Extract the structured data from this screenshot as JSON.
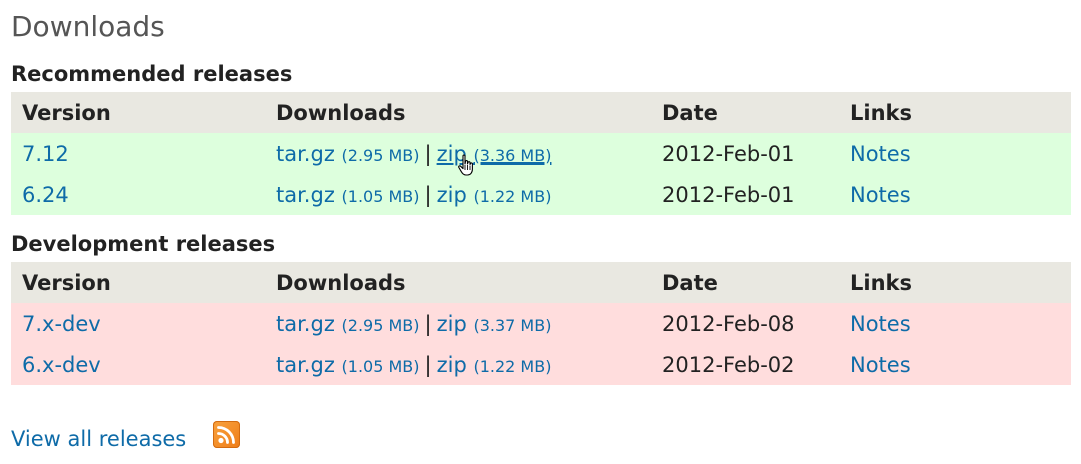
{
  "page": {
    "title": "Downloads"
  },
  "columns": {
    "version": "Version",
    "downloads": "Downloads",
    "date": "Date",
    "links": "Links"
  },
  "recommended": {
    "title": "Recommended releases",
    "rows": [
      {
        "version": "7.12",
        "targz": "tar.gz",
        "targz_size": "(2.95 MB)",
        "separator": "|",
        "zip": "zip",
        "zip_size": "(3.36 MB)",
        "date": "2012-Feb-01",
        "notes": "Notes"
      },
      {
        "version": "6.24",
        "targz": "tar.gz",
        "targz_size": "(1.05 MB)",
        "separator": "|",
        "zip": "zip",
        "zip_size": "(1.22 MB)",
        "date": "2012-Feb-01",
        "notes": "Notes"
      }
    ]
  },
  "development": {
    "title": "Development releases",
    "rows": [
      {
        "version": "7.x-dev",
        "targz": "tar.gz",
        "targz_size": "(2.95 MB)",
        "separator": "|",
        "zip": "zip",
        "zip_size": "(3.37 MB)",
        "date": "2012-Feb-08",
        "notes": "Notes"
      },
      {
        "version": "6.x-dev",
        "targz": "tar.gz",
        "targz_size": "(1.05 MB)",
        "separator": "|",
        "zip": "zip",
        "zip_size": "(1.22 MB)",
        "date": "2012-Feb-02",
        "notes": "Notes"
      }
    ]
  },
  "footer": {
    "view_all": "View all releases",
    "rss_icon": "rss-feed-icon"
  },
  "colors": {
    "link": "#0e6ba8",
    "header_bg": "#e9e8e1",
    "recommended_row_bg": "#ddffdd",
    "development_row_bg": "#ffdddd",
    "rss": "#f28c22"
  }
}
